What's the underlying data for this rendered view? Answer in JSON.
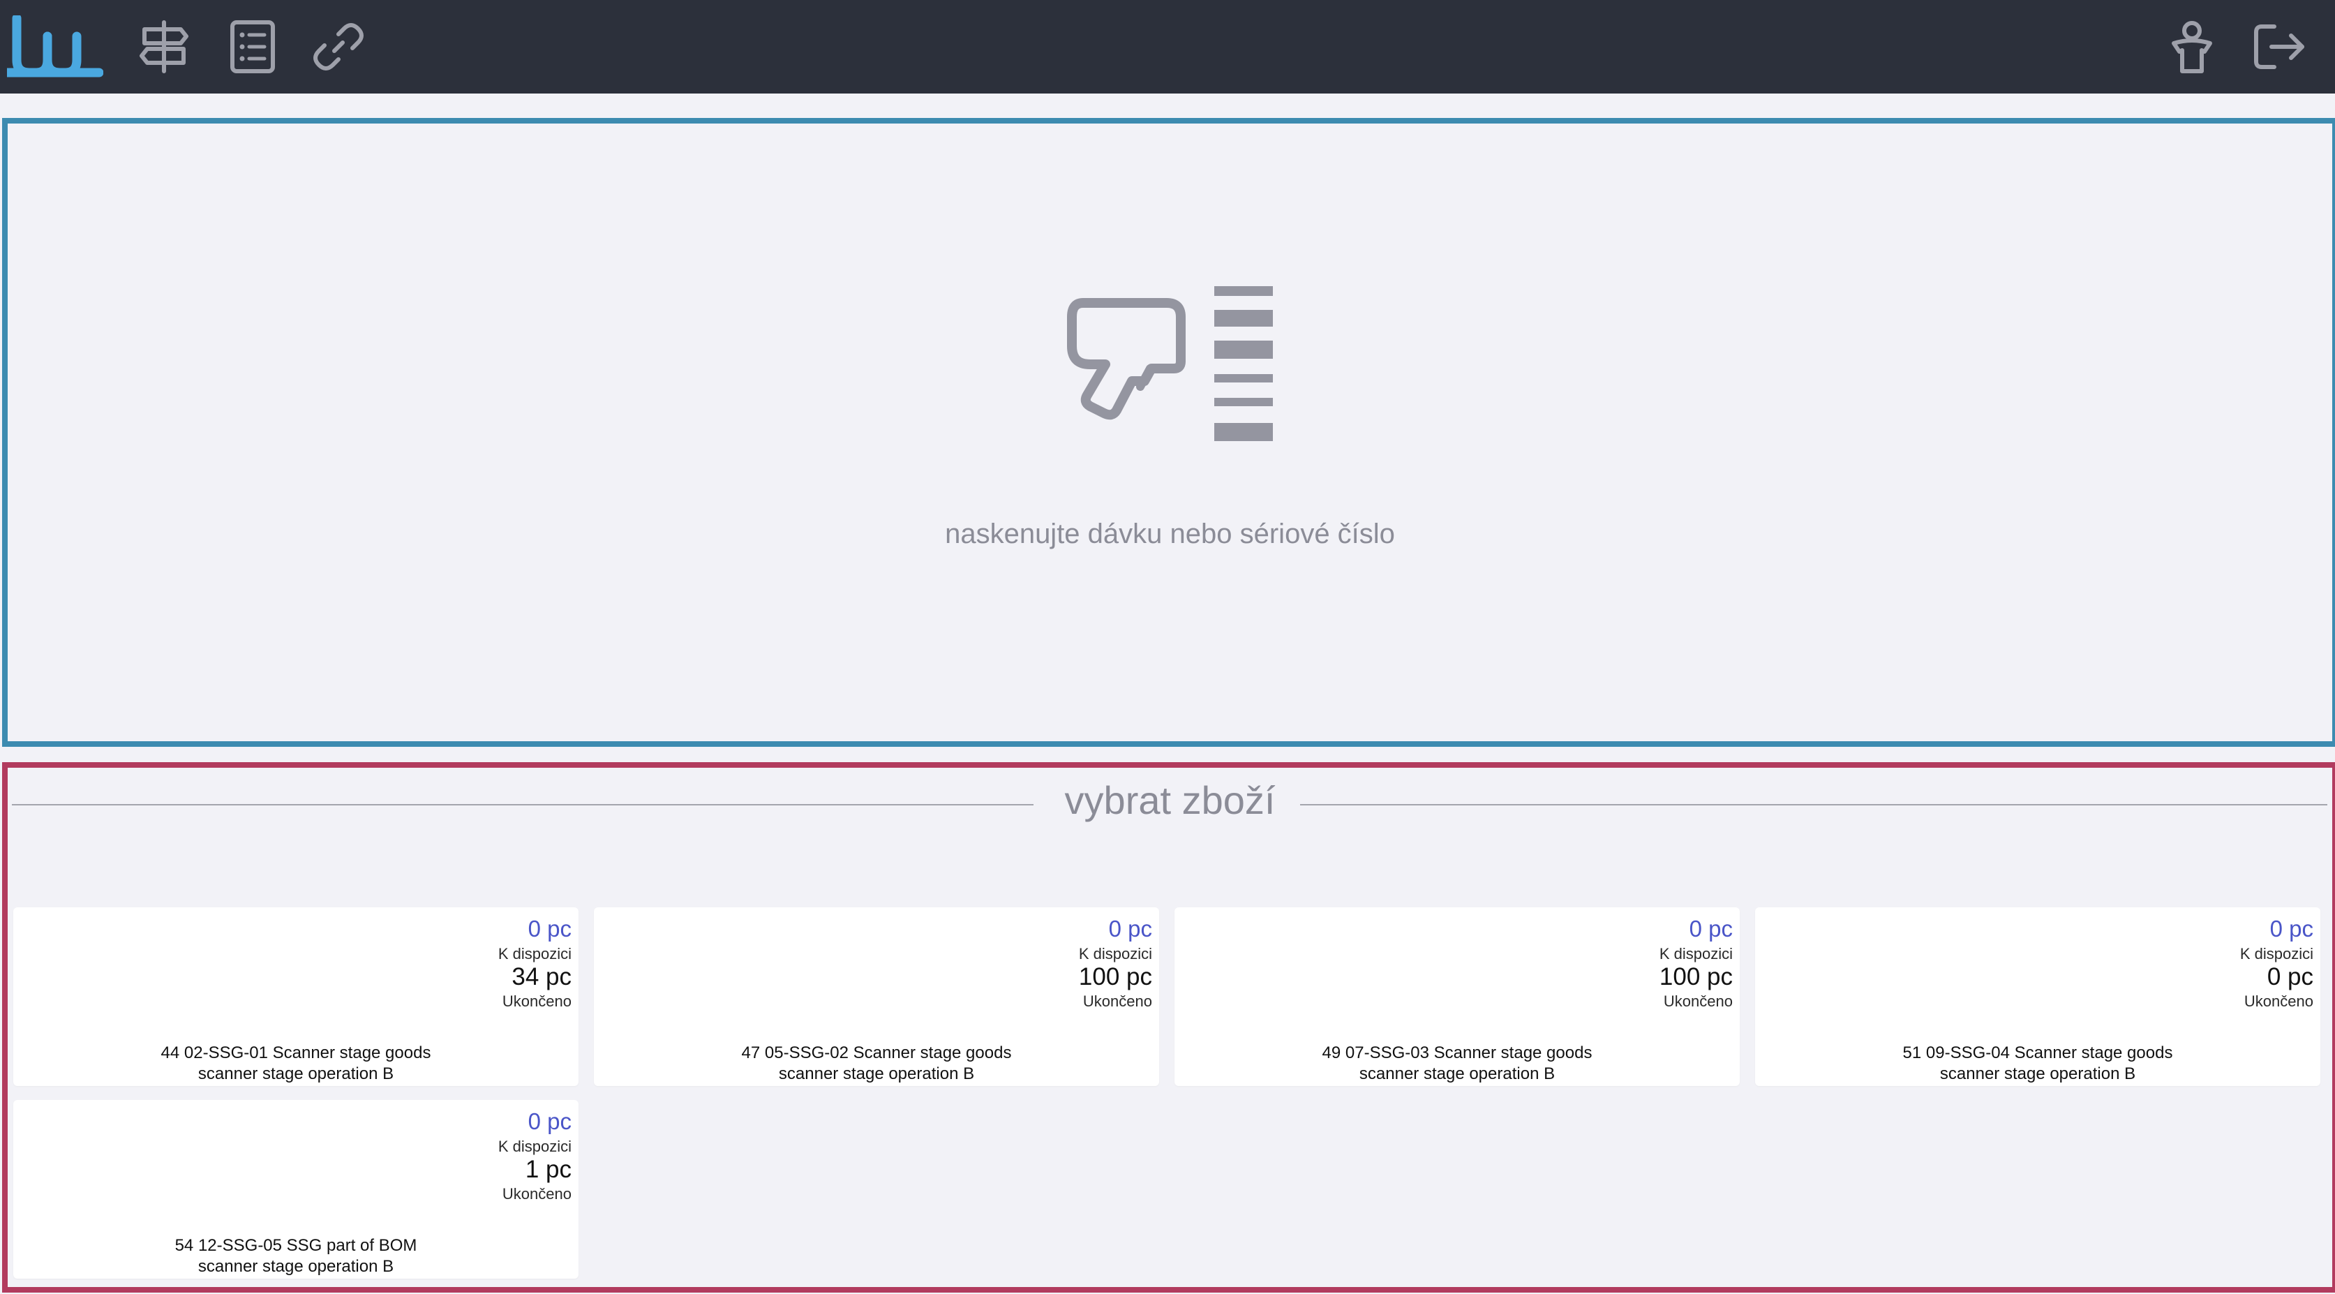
{
  "header": {
    "icons": [
      "app-logo",
      "signpost-icon",
      "list-icon",
      "link-icon",
      "user-icon",
      "logout-icon"
    ]
  },
  "scan": {
    "icon": "barcode-scanner-icon",
    "hint": "naskenujte dávku nebo sériové číslo"
  },
  "goods": {
    "title": "vybrat zboží",
    "items": [
      {
        "qty": "0 pc",
        "available_label": "K dispozici",
        "available": "34 pc",
        "done_label": "Ukončeno",
        "name": "44 02-SSG-01 Scanner stage goods",
        "operation": "scanner stage operation B"
      },
      {
        "qty": "0 pc",
        "available_label": "K dispozici",
        "available": "100 pc",
        "done_label": "Ukončeno",
        "name": "47 05-SSG-02 Scanner stage goods",
        "operation": "scanner stage operation B"
      },
      {
        "qty": "0 pc",
        "available_label": "K dispozici",
        "available": "100 pc",
        "done_label": "Ukončeno",
        "name": "49 07-SSG-03 Scanner stage goods",
        "operation": "scanner stage operation B"
      },
      {
        "qty": "0 pc",
        "available_label": "K dispozici",
        "available": "0 pc",
        "done_label": "Ukončeno",
        "name": "51 09-SSG-04 Scanner stage goods",
        "operation": "scanner stage operation B"
      },
      {
        "qty": "0 pc",
        "available_label": "K dispozici",
        "available": "1 pc",
        "done_label": "Ukončeno",
        "name": "54 12-SSG-05 SSG part of BOM",
        "operation": "scanner stage operation B"
      }
    ]
  },
  "colors": {
    "topbar": "#2c303b",
    "logo": "#4aa8e0",
    "scan_border": "#3d8bb0",
    "goods_border": "#b23b5e",
    "qty_accent": "#4a55c8"
  }
}
